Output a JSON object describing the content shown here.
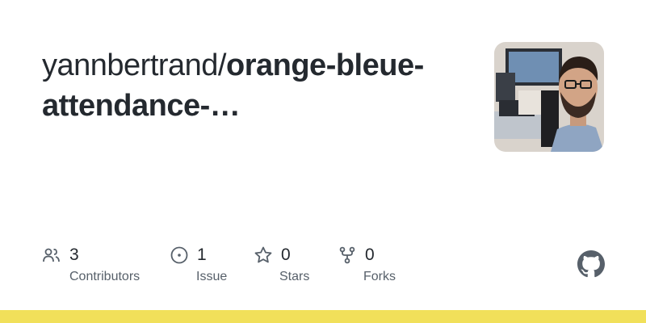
{
  "repo": {
    "owner": "yannbertrand/",
    "name": "orange-bleue-attendance-…"
  },
  "stats": [
    {
      "icon": "people-icon",
      "value": "3",
      "label": "Contributors"
    },
    {
      "icon": "issue-icon",
      "value": "1",
      "label": "Issue"
    },
    {
      "icon": "star-icon",
      "value": "0",
      "label": "Stars"
    },
    {
      "icon": "fork-icon",
      "value": "0",
      "label": "Forks"
    }
  ],
  "colors": {
    "text": "#24292f",
    "muted": "#57606a",
    "language_bar": "#f1e05a"
  },
  "logo": "github-mark-icon"
}
